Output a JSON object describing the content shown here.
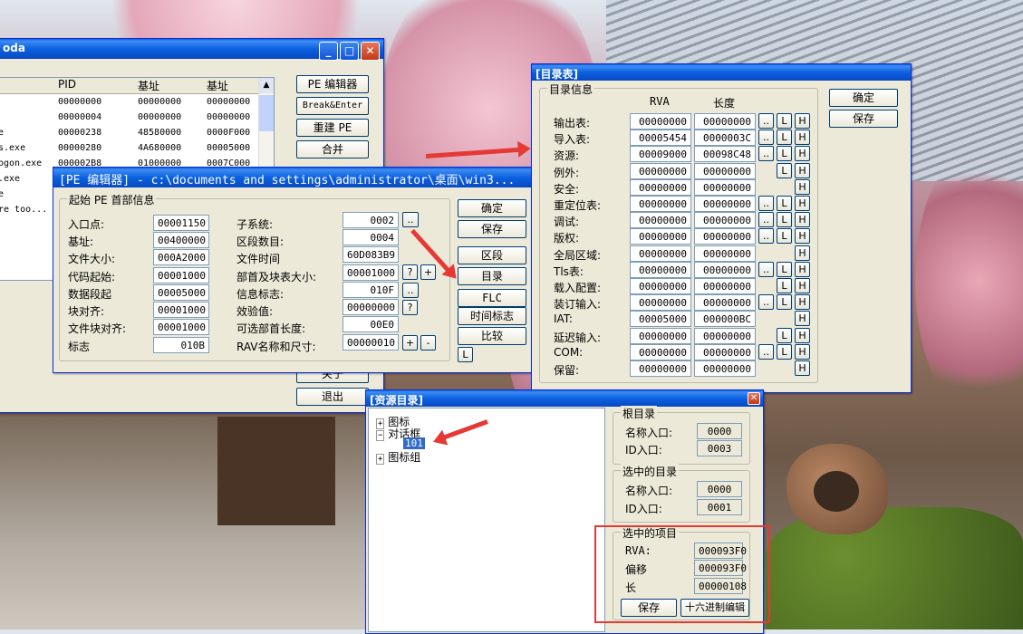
{
  "process_window": {
    "title": "oda",
    "columns": [
      "PID",
      "基址",
      "基址"
    ],
    "rows": [
      {
        "name": "",
        "pid": "00000000",
        "base1": "00000000",
        "base2": "00000000"
      },
      {
        "name": "",
        "pid": "00000004",
        "base1": "00000000",
        "base2": "00000000"
      },
      {
        "name": "e",
        "pid": "00000238",
        "base1": "48580000",
        "base2": "0000F000"
      },
      {
        "name": "s.exe",
        "pid": "00000280",
        "base1": "4A680000",
        "base2": "00005000"
      },
      {
        "name": "ogon.exe",
        "pid": "000002B8",
        "base1": "01000000",
        "base2": "0007C000"
      },
      {
        "name": ".exe",
        "pid": "",
        "base1": "",
        "base2": ""
      },
      {
        "name": "e",
        "pid": "",
        "base1": "",
        "base2": ""
      },
      {
        "name": "re too...",
        "pid": "",
        "base1": "",
        "base2": ""
      }
    ],
    "buttons": {
      "pe_editor": "PE 编辑器",
      "break_enter": "Break&Enter",
      "rebuild_pe": "重建 PE",
      "merge": "合并",
      "about": "关于",
      "exit": "退出"
    }
  },
  "pe_editor": {
    "title": "[PE 编辑器] - c:\\documents and settings\\administrator\\桌面\\win3...",
    "group_title": "起始 PE 首部信息",
    "left_fields": [
      {
        "label": "入口点:",
        "value": "00001150"
      },
      {
        "label": "基址:",
        "value": "00400000"
      },
      {
        "label": "文件大小:",
        "value": "000A2000"
      },
      {
        "label": "代码起始:",
        "value": "00001000"
      },
      {
        "label": "数据段起",
        "value": "00005000"
      },
      {
        "label": "块对齐:",
        "value": "00001000"
      },
      {
        "label": "文件块对齐:",
        "value": "00001000"
      },
      {
        "label": "标志",
        "value": "010B"
      }
    ],
    "right_fields": [
      {
        "label": "子系统:",
        "value": "0002"
      },
      {
        "label": "区段数目:",
        "value": "0004"
      },
      {
        "label": "文件时间",
        "value": "60D083B9"
      },
      {
        "label": "部首及块表大小:",
        "value": "00001000"
      },
      {
        "label": "信息标志:",
        "value": "010F"
      },
      {
        "label": "效验值:",
        "value": "00000000"
      },
      {
        "label": "可选部首长度:",
        "value": "00E0"
      },
      {
        "label": "RAV名称和尺寸:",
        "value": "00000010"
      }
    ],
    "small_buttons": {
      "dots": "..",
      "question": "?",
      "plus": "+",
      "minus": "-"
    },
    "buttons": {
      "ok": "确定",
      "save": "保存",
      "sections": "区段",
      "directories": "目录",
      "flc": "FLC",
      "timestamp": "时间标志",
      "compare": "比较",
      "l": "L"
    }
  },
  "directory_window": {
    "title": "[目录表]",
    "group_title": "目录信息",
    "col_rva": "RVA",
    "col_size": "长度",
    "rows": [
      {
        "label": "输出表:",
        "rva": "00000000",
        "size": "00000000"
      },
      {
        "label": "导入表:",
        "rva": "00005454",
        "size": "0000003C"
      },
      {
        "label": "资源:",
        "rva": "00009000",
        "size": "00098C48"
      },
      {
        "label": "例外:",
        "rva": "00000000",
        "size": "00000000"
      },
      {
        "label": "安全:",
        "rva": "00000000",
        "size": "00000000"
      },
      {
        "label": "重定位表:",
        "rva": "00000000",
        "size": "00000000"
      },
      {
        "label": "调试:",
        "rva": "00000000",
        "size": "00000000"
      },
      {
        "label": "版权:",
        "rva": "00000000",
        "size": "00000000"
      },
      {
        "label": "全局区域:",
        "rva": "00000000",
        "size": "00000000"
      },
      {
        "label": "Tls表:",
        "rva": "00000000",
        "size": "00000000"
      },
      {
        "label": "载入配置:",
        "rva": "00000000",
        "size": "00000000"
      },
      {
        "label": "装订输入:",
        "rva": "00000000",
        "size": "00000000"
      },
      {
        "label": "IAT:",
        "rva": "00005000",
        "size": "000000BC"
      },
      {
        "label": "延迟输入:",
        "rva": "00000000",
        "size": "00000000"
      },
      {
        "label": "COM:",
        "rva": "00000000",
        "size": "00000000"
      },
      {
        "label": "保留:",
        "rva": "00000000",
        "size": "00000000"
      }
    ],
    "btn_dots": "..",
    "btn_l": "L",
    "btn_h": "H",
    "buttons": {
      "ok": "确定",
      "save": "保存"
    }
  },
  "resource_window": {
    "title": "[资源目录]",
    "tree": {
      "icon": "图标",
      "dialog": "对话框",
      "dialog_item": "101",
      "icon_group": "图标组"
    },
    "root_group": "根目录",
    "root_name_label": "名称入口:",
    "root_name_value": "0000",
    "root_id_label": "ID入口:",
    "root_id_value": "0003",
    "sel_dir_group": "选中的目录",
    "sel_name_label": "名称入口:",
    "sel_name_value": "0000",
    "sel_id_label": "ID入口:",
    "sel_id_value": "0001",
    "sel_item_group": "选中的项目",
    "rva_label": "RVA:",
    "rva_value": "000093F0",
    "offset_label": "偏移",
    "offset_value": "000093F0",
    "length_label": "长",
    "length_value": "00000108",
    "save_button": "保存",
    "hex_button": "十六进制编辑"
  }
}
